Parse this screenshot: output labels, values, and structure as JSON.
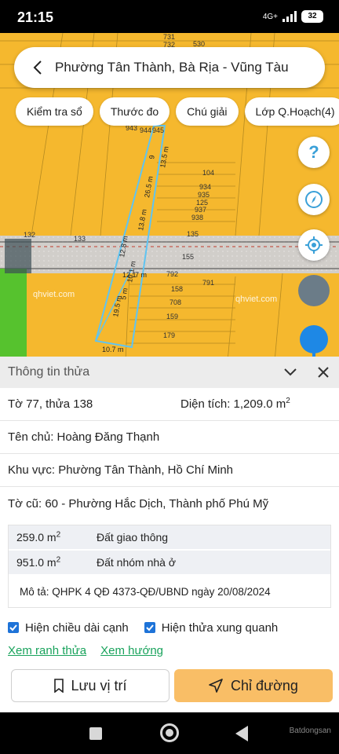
{
  "status": {
    "time": "21:15",
    "network": "4G+",
    "battery": "32"
  },
  "header": {
    "title": "Phường Tân Thành, Bà Rịa - Vũng Tàu"
  },
  "chips": [
    "Kiểm tra sổ",
    "Thước đo",
    "Chú giải",
    "Lớp Q.Hoạch(4)"
  ],
  "map": {
    "lot_numbers": [
      "731",
      "732",
      "530",
      "943",
      "944",
      "945",
      "104",
      "934",
      "935",
      "125",
      "937",
      "938",
      "132",
      "133",
      "135",
      "155",
      "792",
      "791",
      "158",
      "708",
      "159",
      "179"
    ],
    "dimensions": [
      "9",
      "13.5 m",
      "26.5 m",
      "13.8 m",
      "12.8 m",
      "10.1 m",
      "19.5 m",
      "5 m",
      "12.1",
      "7 m",
      "10.7 m"
    ],
    "watermarks": [
      "qhviet.com",
      "qhviet.com"
    ],
    "colors": {
      "residential": "#f5b82e",
      "road": "#d9d9d9",
      "green": "#55c22e",
      "parcel_outline": "#60c3f0"
    }
  },
  "panel": {
    "title": "Thông tin thửa",
    "sheet_lot": "Tờ 77, thửa 138",
    "area_label": "Diện tích: 1,209.0 m",
    "area_unit_sup": "2",
    "owner": "Tên chủ: Hoàng Đăng Thạnh",
    "region": "Khu vực: Phường Tân Thành, Hồ Chí Minh",
    "old_sheet": "Tờ cũ: 60 - Phường Hắc Dịch, Thành phố Phú Mỹ",
    "land_use": [
      {
        "area": "259.0 m",
        "sup": "2",
        "type": "Đất giao thông"
      },
      {
        "area": "951.0 m",
        "sup": "2",
        "type": "Đất nhóm nhà ở"
      }
    ],
    "description": "Mô tả: QHPK 4 QĐ 4373-QĐ/UBND ngày 20/08/2024",
    "checkbox_edges": "Hiện chiều dài cạnh",
    "checkbox_neighbors": "Hiện thửa xung quanh",
    "link_boundary": "Xem ranh thửa",
    "link_direction": "Xem hướng",
    "save_label": "Lưu vị trí",
    "route_label": "Chỉ đường"
  },
  "watermark": "Batdongsan"
}
